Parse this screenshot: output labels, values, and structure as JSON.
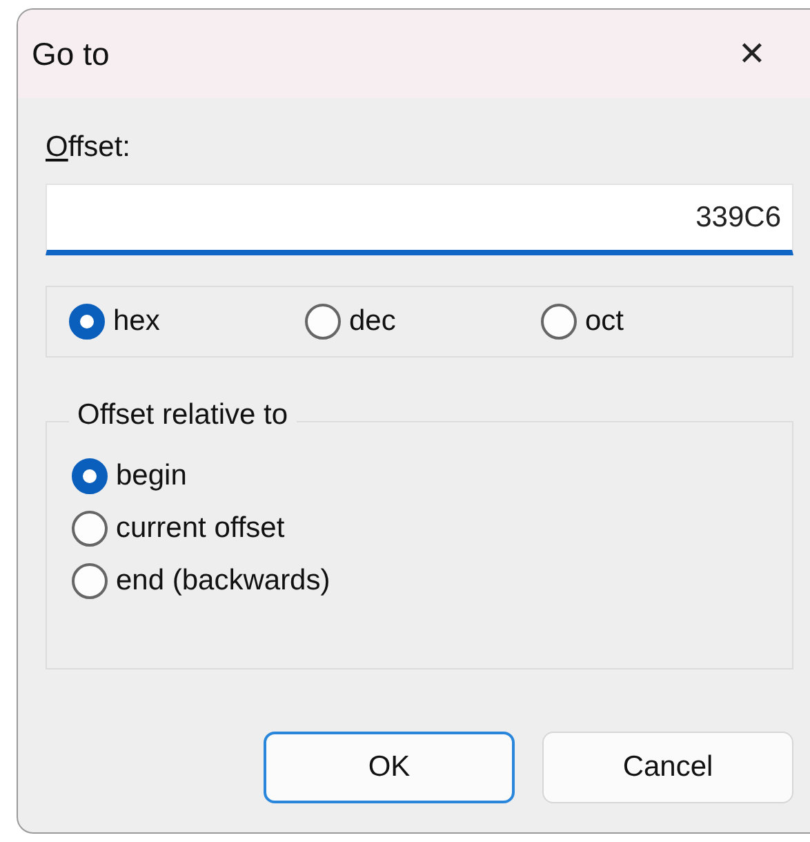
{
  "window": {
    "title": "Go to",
    "close": "✕"
  },
  "offset": {
    "access_key": "O",
    "label_rest": "ffset:",
    "value": "339C6",
    "focused": true
  },
  "bases": [
    {
      "label": "hex",
      "selected": true
    },
    {
      "label": "dec",
      "selected": false
    },
    {
      "label": "oct",
      "selected": false
    }
  ],
  "relative": {
    "title": "Offset relative to",
    "options": [
      {
        "label": "begin",
        "selected": true
      },
      {
        "label": "current offset",
        "selected": false
      },
      {
        "label": "end (backwards)",
        "selected": false
      }
    ]
  },
  "buttons": [
    {
      "label": "OK",
      "default": true
    },
    {
      "label": "Cancel",
      "default": false
    }
  ]
}
